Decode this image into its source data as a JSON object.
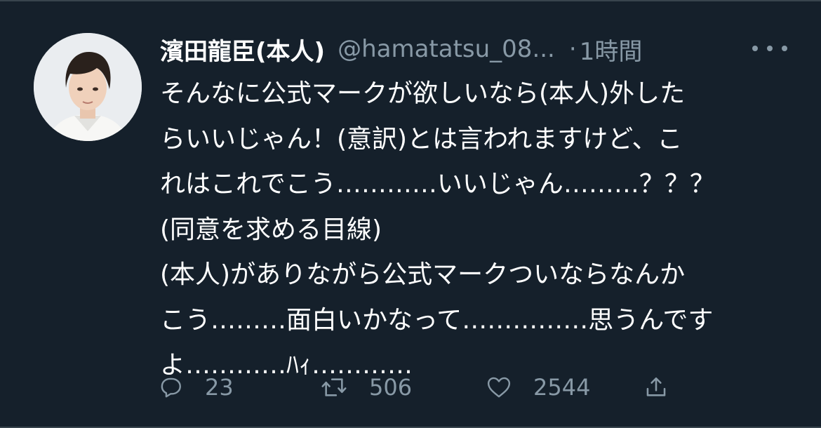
{
  "tweet": {
    "display_name": "濱田龍臣(本人)",
    "handle": "@hamatatsu_08...",
    "separator": "·",
    "time": "1時間",
    "lines": [
      "そんなに公式マークが欲しいなら(本人)外した",
      "らいいじゃん！(意訳)とは言われますけど、こ",
      "れはこれでこう…………いいじゃん………？？？",
      "(同意を求める目線)",
      "(本人)がありながら公式マークついならなんか",
      "こう………面白いかなって……………思うんです",
      "よ…………ﾊｨ…………"
    ]
  },
  "actions": {
    "reply_count": "23",
    "retweet_count": "506",
    "like_count": "2544"
  },
  "icons": {
    "reply": "reply-icon",
    "retweet": "retweet-icon",
    "like": "heart-icon",
    "share": "share-icon",
    "more": "more-icon"
  },
  "colors": {
    "background": "#15202b",
    "secondary_text": "#8899a6",
    "primary_text": "#ffffff",
    "divider": "#38444d"
  }
}
